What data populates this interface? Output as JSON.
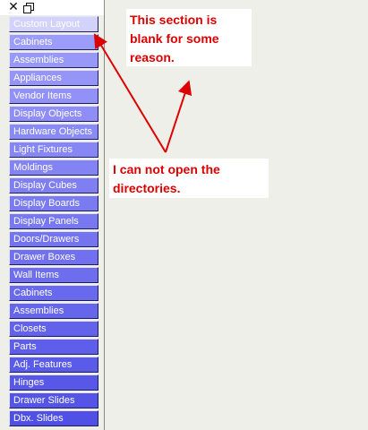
{
  "toolbar": {
    "close_icon": "close-icon",
    "restore_icon": "restore-icon"
  },
  "categories": [
    {
      "label": "Custom Layout",
      "state": "selected"
    },
    {
      "label": "Cabinets",
      "state": "normal"
    },
    {
      "label": "Assemblies",
      "state": "normal"
    },
    {
      "label": "Appliances",
      "state": "normal"
    },
    {
      "label": "Vendor Items",
      "state": "normal"
    },
    {
      "label": "Display Objects",
      "state": "normal"
    },
    {
      "label": "Hardware Objects",
      "state": "normal"
    },
    {
      "label": "Light Fixtures",
      "state": "normal"
    },
    {
      "label": "Moldings",
      "state": "normal"
    },
    {
      "label": "Display Cubes",
      "state": "normal"
    },
    {
      "label": "Display Boards",
      "state": "normal"
    },
    {
      "label": "Display Panels",
      "state": "normal"
    },
    {
      "label": "Doors/Drawers",
      "state": "normal"
    },
    {
      "label": "Drawer Boxes",
      "state": "normal"
    },
    {
      "label": "Wall Items",
      "state": "normal"
    },
    {
      "label": "Cabinets",
      "state": "normal"
    },
    {
      "label": "Assemblies",
      "state": "normal"
    },
    {
      "label": "Closets",
      "state": "normal"
    },
    {
      "label": "Parts",
      "state": "normal"
    },
    {
      "label": "Adj. Features",
      "state": "normal"
    },
    {
      "label": "Hinges",
      "state": "normal"
    },
    {
      "label": "Drawer Slides",
      "state": "normal"
    },
    {
      "label": "Dbx. Slides",
      "state": "normal"
    }
  ],
  "annotations": {
    "blank_note": "This section is blank for some reason.",
    "directories_note": "I can not open the directories."
  },
  "colors": {
    "annotation_text": "#dd0000",
    "arrow": "#dd0000",
    "panel_background": "#efefe9",
    "selected_button": "#d2d2fa",
    "button_top": "#9c9cfa",
    "button_bottom": "#5050e6"
  }
}
